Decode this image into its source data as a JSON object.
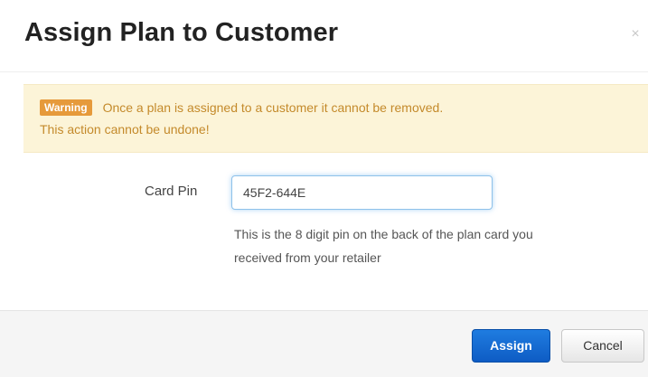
{
  "dialog": {
    "title": "Assign Plan to Customer",
    "close_label": "×"
  },
  "alert": {
    "badge": "Warning",
    "line1": "Once a plan is assigned to a customer it cannot be removed.",
    "line2": "This action cannot be undone!"
  },
  "form": {
    "card_pin_label": "Card Pin",
    "card_pin_value": "45F2-644E",
    "help_line1": "This is the 8 digit pin on the back of the plan card you",
    "help_line2": "received from your retailer"
  },
  "footer": {
    "assign_label": "Assign",
    "cancel_label": "Cancel"
  },
  "colors": {
    "primary_button": "#1366d6",
    "warning_background": "#fcf4d8",
    "warning_text": "#c48a2b",
    "warning_badge": "#e69a3b",
    "input_focus_border": "#8ec1ea"
  },
  "icons": {
    "close": "close-icon"
  }
}
